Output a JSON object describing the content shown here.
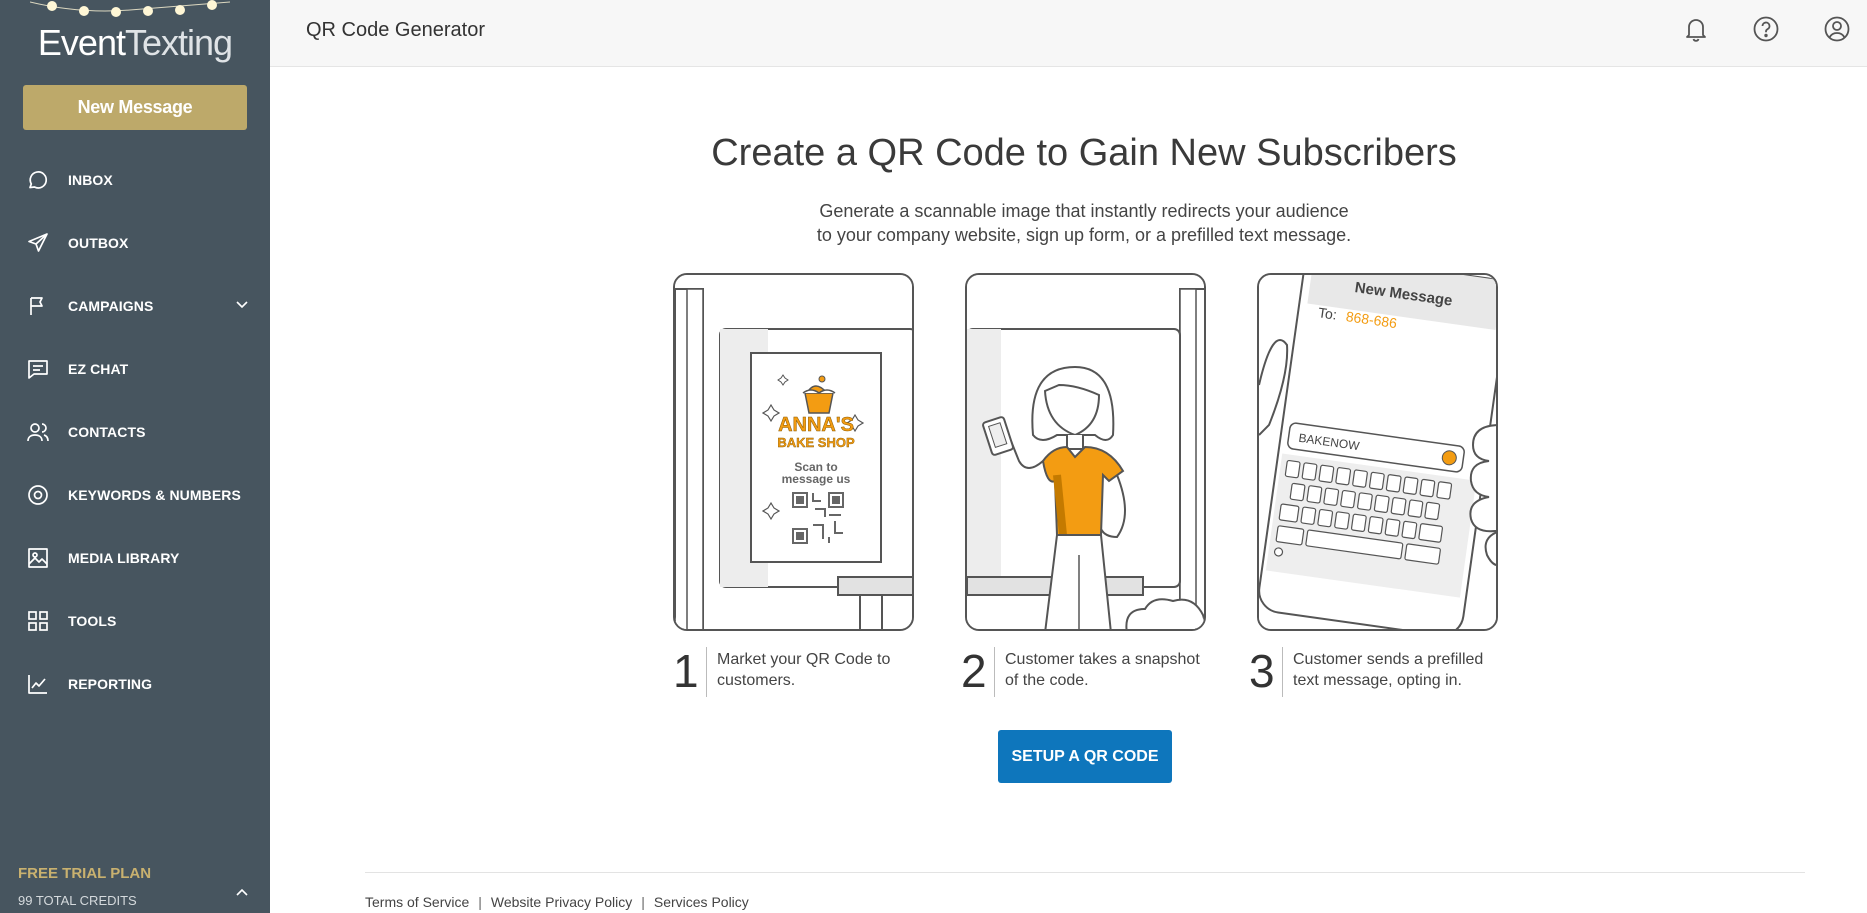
{
  "brand": {
    "logo_word1": "Event",
    "logo_word2": "Texting",
    "accent": "#bda96a",
    "sidebar_bg": "#47555f",
    "primary_button": "#0e76bc",
    "illustration_orange": "#f39c12"
  },
  "sidebar": {
    "new_message_label": "New Message",
    "items": [
      {
        "label": "INBOX",
        "icon": "chat-bubble-icon"
      },
      {
        "label": "OUTBOX",
        "icon": "paper-plane-icon"
      },
      {
        "label": "CAMPAIGNS",
        "icon": "flag-icon",
        "has_submenu": true
      },
      {
        "label": "EZ CHAT",
        "icon": "message-square-icon"
      },
      {
        "label": "CONTACTS",
        "icon": "users-icon"
      },
      {
        "label": "KEYWORDS & NUMBERS",
        "icon": "target-icon"
      },
      {
        "label": "MEDIA LIBRARY",
        "icon": "image-icon"
      },
      {
        "label": "TOOLS",
        "icon": "grid-icon"
      },
      {
        "label": "REPORTING",
        "icon": "line-chart-icon"
      }
    ],
    "plan": {
      "title": "FREE TRIAL PLAN",
      "credits": "99 TOTAL CREDITS"
    }
  },
  "header": {
    "title": "QR Code Generator",
    "icons": [
      "bell-icon",
      "help-icon",
      "user-account-icon"
    ]
  },
  "main": {
    "headline": "Create a QR Code to Gain New Subscribers",
    "subtitle_line1": "Generate a scannable image that instantly redirects your audience",
    "subtitle_line2": "to your company website, sign up form, or a prefilled text message.",
    "steps": [
      {
        "number": "1",
        "line1": "Market your QR Code to",
        "line2": "customers."
      },
      {
        "number": "2",
        "line1": "Customer takes a snapshot",
        "line2": "of the code."
      },
      {
        "number": "3",
        "line1": "Customer sends a prefilled",
        "line2": "text message, opting in."
      }
    ],
    "illustration1": {
      "shop_line1": "ANNA'S",
      "shop_line2": "BAKE SHOP",
      "scan_line1": "Scan to",
      "scan_line2": "message us"
    },
    "illustration3": {
      "title": "New Message",
      "to_label": "To:",
      "to_number": "868-686",
      "keyword": "BAKENOW"
    },
    "setup_button": "SETUP A QR CODE"
  },
  "footer": {
    "links": [
      "Terms of Service",
      "Website Privacy Policy",
      "Services Policy"
    ],
    "separator": "|"
  }
}
